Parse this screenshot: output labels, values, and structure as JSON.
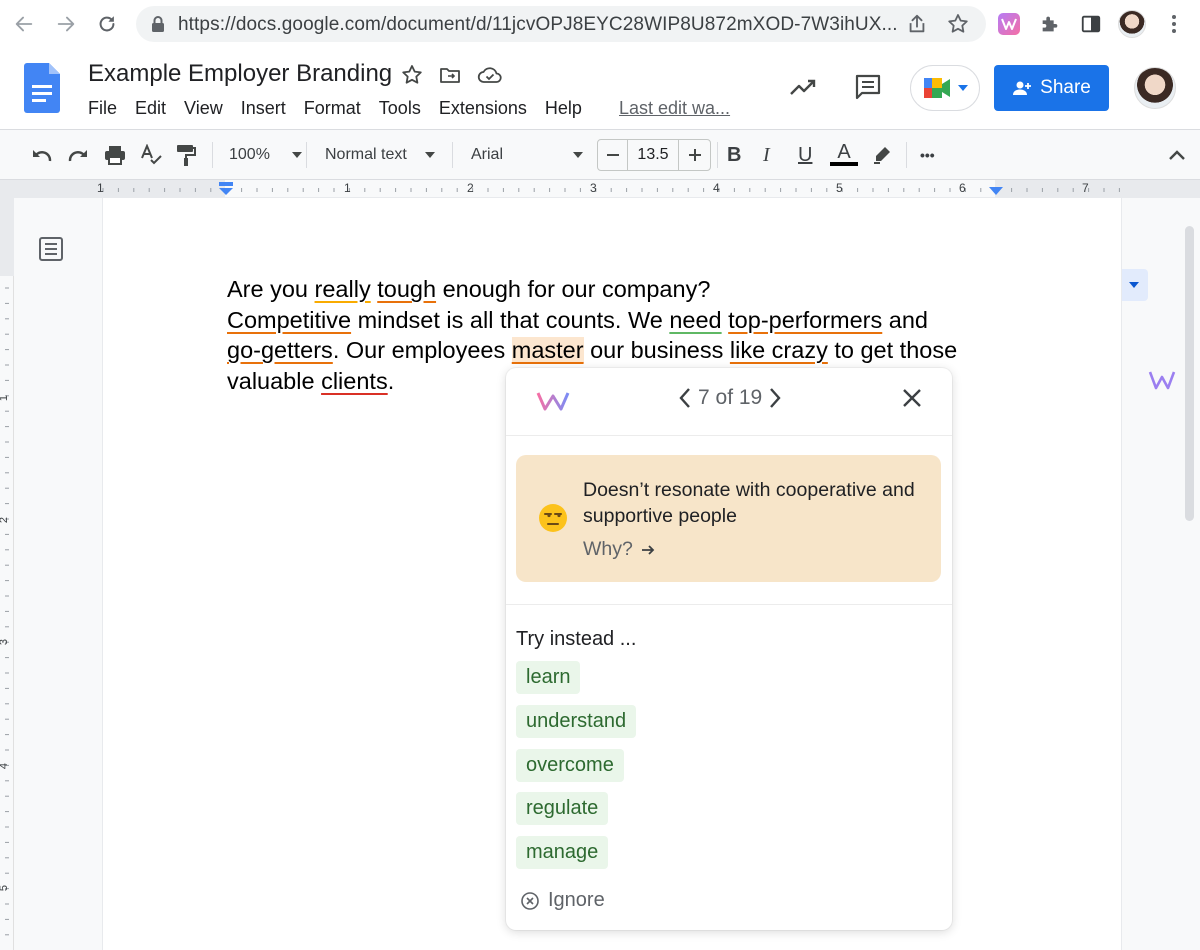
{
  "browser": {
    "url": "https://docs.google.com/document/d/11jcvOPJ8EYC28WIP8U872mXOD-7W3ihUX..."
  },
  "docs": {
    "title": "Example Employer Branding",
    "menu": [
      "File",
      "Edit",
      "View",
      "Insert",
      "Format",
      "Tools",
      "Extensions",
      "Help"
    ],
    "last_edit": "Last edit wa...",
    "share_label": "Share"
  },
  "toolbar": {
    "zoom": "100%",
    "style": "Normal text",
    "font": "Arial",
    "font_size": "13.5",
    "bold": "B",
    "italic": "I",
    "underline": "U",
    "text_color": "A",
    "more": "•••"
  },
  "ruler": {
    "numbers": [
      "1",
      "1",
      "2",
      "3",
      "4",
      "5",
      "6",
      "7"
    ],
    "vnumbers": [
      "1",
      "2",
      "3",
      "4",
      "5"
    ]
  },
  "document": {
    "line1": [
      "Are you ",
      "really",
      " ",
      "tough",
      " enough for our company?"
    ],
    "line2": [
      "Competitive",
      " mindset is all that counts. We ",
      "need",
      " ",
      "top-performers",
      " and"
    ],
    "line3": [
      "go-getters",
      ". Our employees ",
      "master",
      " our business ",
      "like crazy",
      " to get those"
    ],
    "line4": [
      "valuable ",
      "clients",
      "."
    ]
  },
  "popup": {
    "counter": "7 of 19",
    "message": "Doesn’t resonate with cooperative and supportive people",
    "why_label": "Why?",
    "try_instead": "Try instead ...",
    "suggestions": [
      "learn",
      "understand",
      "overcome",
      "regulate",
      "manage"
    ],
    "ignore_label": "Ignore"
  },
  "colors": {
    "share_blue": "#1a73e8",
    "card_bg": "#f7e5c9",
    "chip_bg": "#eaf6ea",
    "underline_orange": "#e8710a",
    "underline_yellow": "#f9ab00",
    "underline_red": "#d93025",
    "underline_green": "#5fb864"
  },
  "icons": [
    "back-arrow-icon",
    "forward-arrow-icon",
    "reload-icon",
    "lock-icon",
    "share-page-icon",
    "bookmark-star-icon",
    "witty-extension-icon",
    "extensions-puzzle-icon",
    "side-panel-icon",
    "profile-avatar",
    "chrome-menu-icon",
    "docs-logo-icon",
    "star-icon",
    "move-folder-icon",
    "cloud-status-icon",
    "activity-trend-icon",
    "comments-icon",
    "meet-icon",
    "undo-icon",
    "redo-icon",
    "print-icon",
    "spellcheck-icon",
    "paint-format-icon",
    "highlighter-icon",
    "edit-mode-icon",
    "collapse-icon",
    "outline-icon",
    "witty-logo-icon",
    "chevron-left-icon",
    "chevron-right-icon",
    "close-icon",
    "unamused-emoji-icon",
    "arrow-right-icon",
    "ignore-circle-x-icon"
  ]
}
